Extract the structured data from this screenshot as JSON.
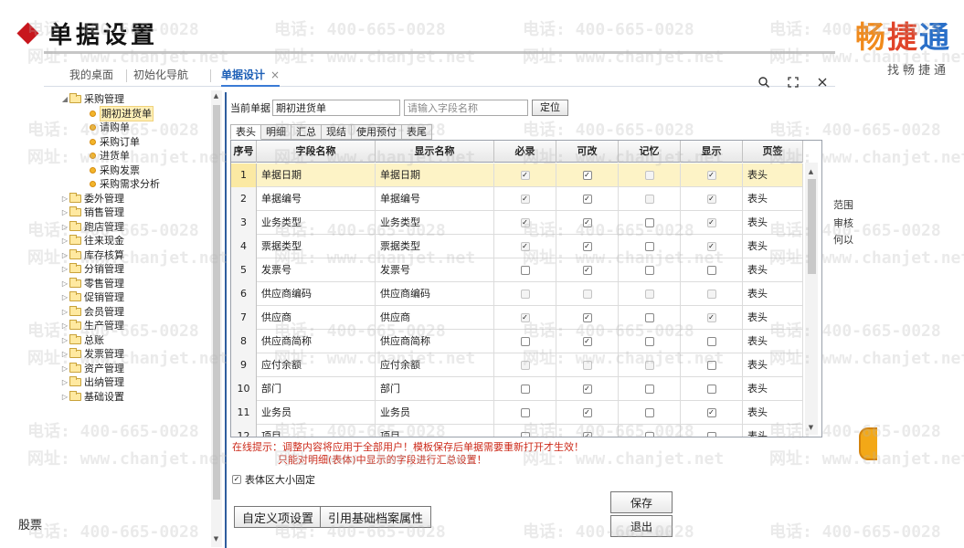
{
  "slide": {
    "title": "单据设置",
    "logo": "畅捷通",
    "logo_sub": "找畅捷通",
    "bottom_left": "股票"
  },
  "watermark": {
    "phone": "电话: 400-665-0028",
    "site": "网址: www.chanjet.net"
  },
  "tabs": [
    {
      "label": "我的桌面"
    },
    {
      "label": "初始化导航"
    },
    {
      "label": "单据设计",
      "active": true,
      "close": "×"
    }
  ],
  "top_icons": [
    "search-icon",
    "fullscreen-icon",
    "close-icon"
  ],
  "tree": {
    "items": [
      {
        "label": "采购管理",
        "level": 0,
        "expanded": true
      },
      {
        "label": "期初进货单",
        "level": 1,
        "selected": true
      },
      {
        "label": "请购单",
        "level": 1
      },
      {
        "label": "采购订单",
        "level": 1
      },
      {
        "label": "进货单",
        "level": 1
      },
      {
        "label": "采购发票",
        "level": 1
      },
      {
        "label": "采购需求分析",
        "level": 1
      },
      {
        "label": "委外管理",
        "level": 0
      },
      {
        "label": "销售管理",
        "level": 0
      },
      {
        "label": "跑店管理",
        "level": 0
      },
      {
        "label": "往来现金",
        "level": 0
      },
      {
        "label": "库存核算",
        "level": 0
      },
      {
        "label": "分销管理",
        "level": 0
      },
      {
        "label": "零售管理",
        "level": 0
      },
      {
        "label": "促销管理",
        "level": 0
      },
      {
        "label": "会员管理",
        "level": 0
      },
      {
        "label": "生产管理",
        "level": 0
      },
      {
        "label": "总账",
        "level": 0
      },
      {
        "label": "发票管理",
        "level": 0
      },
      {
        "label": "资产管理",
        "level": 0
      },
      {
        "label": "出纳管理",
        "level": 0
      },
      {
        "label": "基础设置",
        "level": 0
      }
    ]
  },
  "form": {
    "current_label": "当前单据",
    "current_value": "期初进货单",
    "search_placeholder": "请输入字段名称",
    "locate_button": "定位"
  },
  "subtabs": [
    "表头",
    "明细",
    "汇总",
    "现结",
    "使用预付",
    "表尾"
  ],
  "grid": {
    "columns": [
      "序号",
      "字段名称",
      "显示名称",
      "必录",
      "可改",
      "记忆",
      "显示",
      "页签"
    ],
    "rows": [
      {
        "no": "1",
        "field": "单据日期",
        "display": "单据日期",
        "required": "on-dis",
        "editable": "on",
        "memory": "off-dis",
        "show": "on-dis",
        "tab": "表头",
        "selected": true
      },
      {
        "no": "2",
        "field": "单据编号",
        "display": "单据编号",
        "required": "on-dis",
        "editable": "on",
        "memory": "off-dis",
        "show": "on-dis",
        "tab": "表头"
      },
      {
        "no": "3",
        "field": "业务类型",
        "display": "业务类型",
        "required": "on-dis",
        "editable": "on",
        "memory": "off",
        "show": "on-dis",
        "tab": "表头"
      },
      {
        "no": "4",
        "field": "票据类型",
        "display": "票据类型",
        "required": "on-dis",
        "editable": "on",
        "memory": "off",
        "show": "on-dis",
        "tab": "表头"
      },
      {
        "no": "5",
        "field": "发票号",
        "display": "发票号",
        "required": "off",
        "editable": "on",
        "memory": "off",
        "show": "off",
        "tab": "表头"
      },
      {
        "no": "6",
        "field": "供应商编码",
        "display": "供应商编码",
        "required": "off-dis",
        "editable": "off-dis",
        "memory": "off-dis",
        "show": "off-dis",
        "tab": "表头"
      },
      {
        "no": "7",
        "field": "供应商",
        "display": "供应商",
        "required": "on-dis",
        "editable": "on",
        "memory": "off",
        "show": "on-dis",
        "tab": "表头"
      },
      {
        "no": "8",
        "field": "供应商简称",
        "display": "供应商简称",
        "required": "off",
        "editable": "on",
        "memory": "off",
        "show": "off",
        "tab": "表头"
      },
      {
        "no": "9",
        "field": "应付余额",
        "display": "应付余额",
        "required": "off-dis",
        "editable": "off-dis",
        "memory": "off-dis",
        "show": "off",
        "tab": "表头"
      },
      {
        "no": "10",
        "field": "部门",
        "display": "部门",
        "required": "off",
        "editable": "on",
        "memory": "off",
        "show": "off",
        "tab": "表头"
      },
      {
        "no": "11",
        "field": "业务员",
        "display": "业务员",
        "required": "off",
        "editable": "on",
        "memory": "off",
        "show": "on",
        "tab": "表头"
      },
      {
        "no": "12",
        "field": "项目",
        "display": "项目",
        "required": "off",
        "editable": "on",
        "memory": "off",
        "show": "off",
        "tab": "表头"
      }
    ]
  },
  "hint": {
    "line1": "在线提示：调整内容将应用于全部用户！模板保存后单据需要重新打开才生效！",
    "line2": "只能对明细(表体)中显示的字段进行汇总设置！"
  },
  "fix_size_label": "表体区大小固定",
  "buttons": {
    "custom": "自定义项设置",
    "reference": "引用基础档案属性",
    "save": "保存",
    "exit": "退出"
  },
  "side_texts": [
    "范围",
    "审核",
    "何以"
  ]
}
